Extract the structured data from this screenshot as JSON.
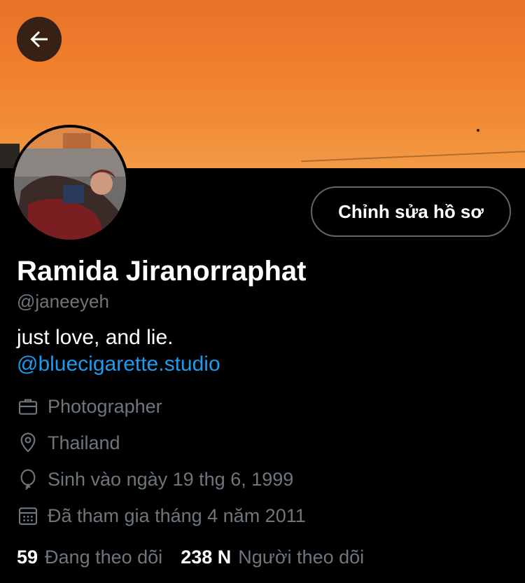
{
  "header": {
    "back_icon": "arrow-left-icon"
  },
  "profile": {
    "edit_button_label": "Chỉnh sửa hồ sơ",
    "display_name": "Ramida Jiranorraphat",
    "handle": "@janeeyeh",
    "bio": "just love, and lie.",
    "bio_link": "@bluecigarette.studio",
    "link_color": "#1d9bf0",
    "details": [
      {
        "icon": "briefcase-icon",
        "text": "Photographer"
      },
      {
        "icon": "location-pin-icon",
        "text": "Thailand"
      },
      {
        "icon": "balloon-icon",
        "text": "Sinh vào ngày 19 thg 6, 1999"
      },
      {
        "icon": "calendar-icon",
        "text": "Đã tham gia tháng 4 năm 2011"
      }
    ],
    "stats": {
      "following_count": "59",
      "following_label": "Đang theo dõi",
      "followers_count": "238 N",
      "followers_label": "Người theo dõi"
    }
  }
}
